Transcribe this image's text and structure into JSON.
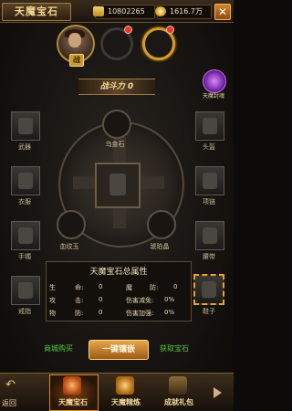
{
  "header": {
    "title": "天魔宝石",
    "gold": "10802265",
    "yuanbao": "1616.7万",
    "close": "✕"
  },
  "hero": {
    "badge": "战"
  },
  "power": {
    "label": "战斗力 0"
  },
  "demon_seal": {
    "label": "天魔封魂"
  },
  "equipment": {
    "left": [
      "武器",
      "衣服",
      "手镯",
      "戒指"
    ],
    "right": [
      "头盔",
      "项链",
      "腰带",
      "鞋子"
    ]
  },
  "gems": {
    "top": "乌金石",
    "left": "血纹玉",
    "right": "琥珀晶"
  },
  "attributes": {
    "title": "天魔宝石总属性",
    "rows": [
      {
        "k": "生",
        "k2": "命:",
        "v": "0"
      },
      {
        "k": "攻",
        "k2": "击:",
        "v": "0"
      },
      {
        "k": "物",
        "k2": "防:",
        "v": "0"
      },
      {
        "k": "魔",
        "k2": "防:",
        "v": "0"
      },
      {
        "k": "伤害减免:",
        "k2": "",
        "v": "0%"
      },
      {
        "k": "伤害加强:",
        "k2": "",
        "v": "0%"
      }
    ]
  },
  "actions": {
    "shop": "商城购买",
    "inlay": "一键镶嵌",
    "obtain": "获取宝石"
  },
  "nav": {
    "back": "返回",
    "tabs": [
      "天魔宝石",
      "天魔精炼",
      "成就礼包"
    ]
  },
  "colors": {
    "accent": "#e0a630",
    "green": "#56c93f"
  }
}
